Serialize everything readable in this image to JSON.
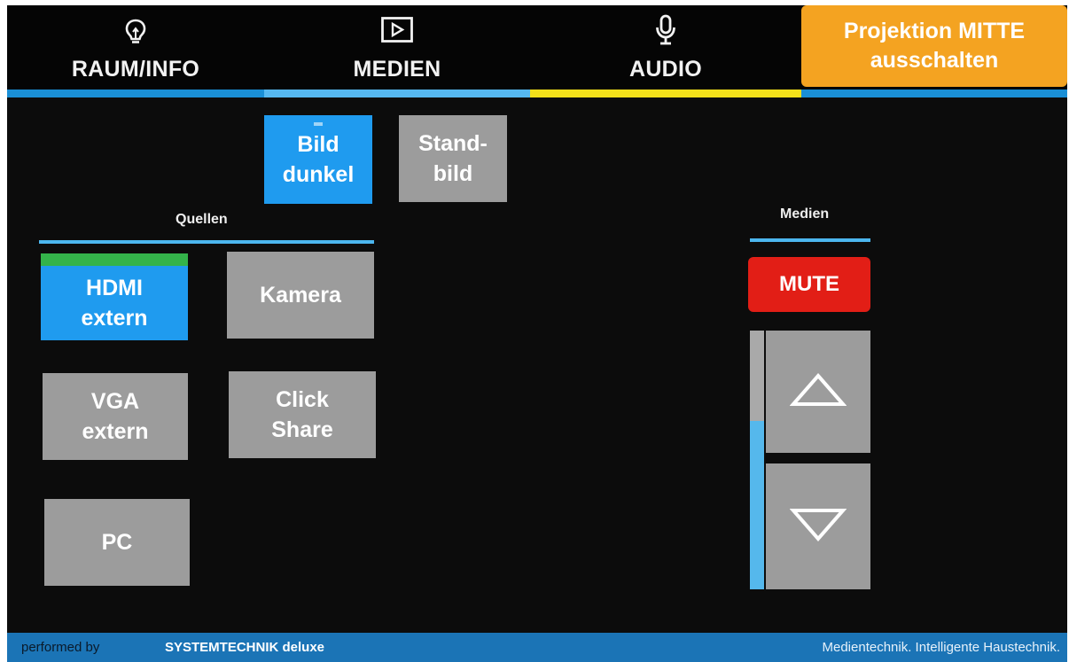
{
  "nav": {
    "tabs": [
      {
        "label": "RAUM/INFO",
        "icon": "lightbulb-icon",
        "accent": "#1a8fd6"
      },
      {
        "label": "MEDIEN",
        "icon": "play-screen-icon",
        "accent": "#56b8f0"
      },
      {
        "label": "AUDIO",
        "icon": "microphone-icon",
        "accent": "#f3e01a"
      }
    ],
    "off_button": {
      "line1": "Projektion MITTE",
      "line2": "ausschalten",
      "color": "#f4a321"
    }
  },
  "image_controls": {
    "bild_dunkel": {
      "line1": "Bild",
      "line2": "dunkel"
    },
    "standbild": {
      "line1": "Stand-",
      "line2": "bild"
    }
  },
  "sources": {
    "title": "Quellen",
    "items": [
      {
        "line1": "HDMI",
        "line2": "extern",
        "active": true
      },
      {
        "line1": "Kamera",
        "line2": ""
      },
      {
        "line1": "VGA",
        "line2": "extern"
      },
      {
        "line1": "Click",
        "line2": "Share"
      },
      {
        "line1": "PC",
        "line2": ""
      }
    ]
  },
  "media": {
    "title": "Medien",
    "mute_label": "MUTE",
    "volume_level": 0.65,
    "colors": {
      "mute": "#e21e16",
      "volume_fill": "#55b8ec"
    }
  },
  "footer": {
    "performed_by": "performed by",
    "brand": "SYSTEMTECHNIK deluxe",
    "tagline": "Medientechnik. Intelligente Haustechnik."
  },
  "colors": {
    "accent_blue": "#1f9bef",
    "button_gray": "#9c9c9c",
    "active_green": "#34b34a"
  }
}
